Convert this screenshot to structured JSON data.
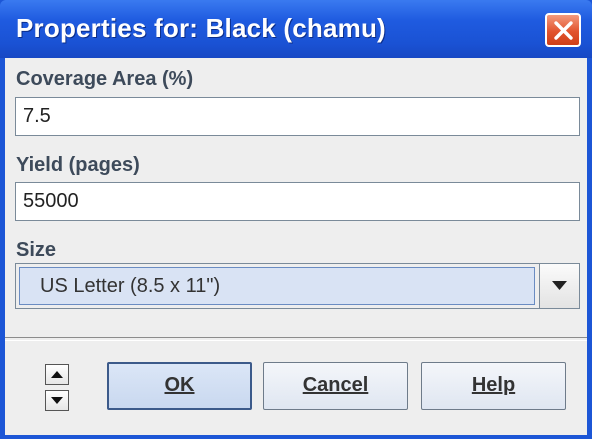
{
  "window": {
    "title": "Properties for: Black (chamu)"
  },
  "form": {
    "coverage": {
      "label": "Coverage Area (%)",
      "value": "7.5"
    },
    "yield": {
      "label": "Yield (pages)",
      "value": "55000"
    },
    "size": {
      "label": "Size",
      "selected": "US Letter (8.5 x 11\")"
    }
  },
  "buttons": {
    "ok": "OK",
    "cancel": "Cancel",
    "help": "Help"
  },
  "icons": {
    "close": "close-icon",
    "dropdown": "chevron-down-icon",
    "scroll_up": "triangle-up-icon",
    "scroll_down": "triangle-down-icon"
  },
  "colors": {
    "title_bar": "#1f5be0",
    "close_button": "#e2542e",
    "dialog_background": "#eeeeee",
    "selected_item": "#d9e3f4"
  }
}
